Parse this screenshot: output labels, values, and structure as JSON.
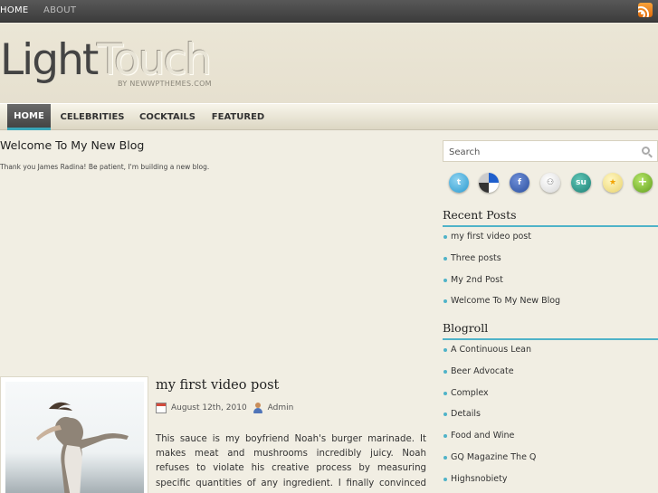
{
  "topbar": {
    "links": [
      "HOME",
      "ABOUT"
    ],
    "rss_icon": "rss-icon"
  },
  "header": {
    "logo_part1": "Light",
    "logo_part2": "Touch",
    "byline": "BY NEWWPTHEMES.COM"
  },
  "nav": {
    "items": [
      "HOME",
      "CELEBRITIES",
      "COCKTAILS",
      "FEATURED"
    ],
    "active": "HOME",
    "accent_color": "#3aa6b9"
  },
  "intro_post": {
    "title": "Welcome To My New Blog",
    "body": "Thank you James Radina! Be patient, I'm building a new blog."
  },
  "video_post": {
    "title": "my first video post",
    "date": "August 12th, 2010",
    "author": "Admin",
    "excerpt": "This sauce is my boyfriend Noah's burger marinade. It makes meat and mushrooms incredibly juicy. Noah refuses to violate his creative process by measuring specific quantities of any ingredient. I finally convinced him to use a vague \"part\" scale,"
  },
  "sidebar": {
    "search_placeholder": "Search",
    "social_icons": [
      "twitter-icon",
      "delicious-icon",
      "facebook-icon",
      "myspace-icon",
      "stumbleupon-icon",
      "favorites-icon",
      "share-plus-icon"
    ],
    "recent_posts_title": "Recent Posts",
    "recent_posts": [
      "my first video post",
      "Three posts",
      "My 2nd Post",
      "Welcome To My New Blog"
    ],
    "blogroll_title": "Blogroll",
    "blogroll": [
      "A Continuous Lean",
      "Beer Advocate",
      "Complex",
      "Details",
      "Food and Wine",
      "GQ Magazine The Q",
      "Highsnobiety"
    ]
  }
}
